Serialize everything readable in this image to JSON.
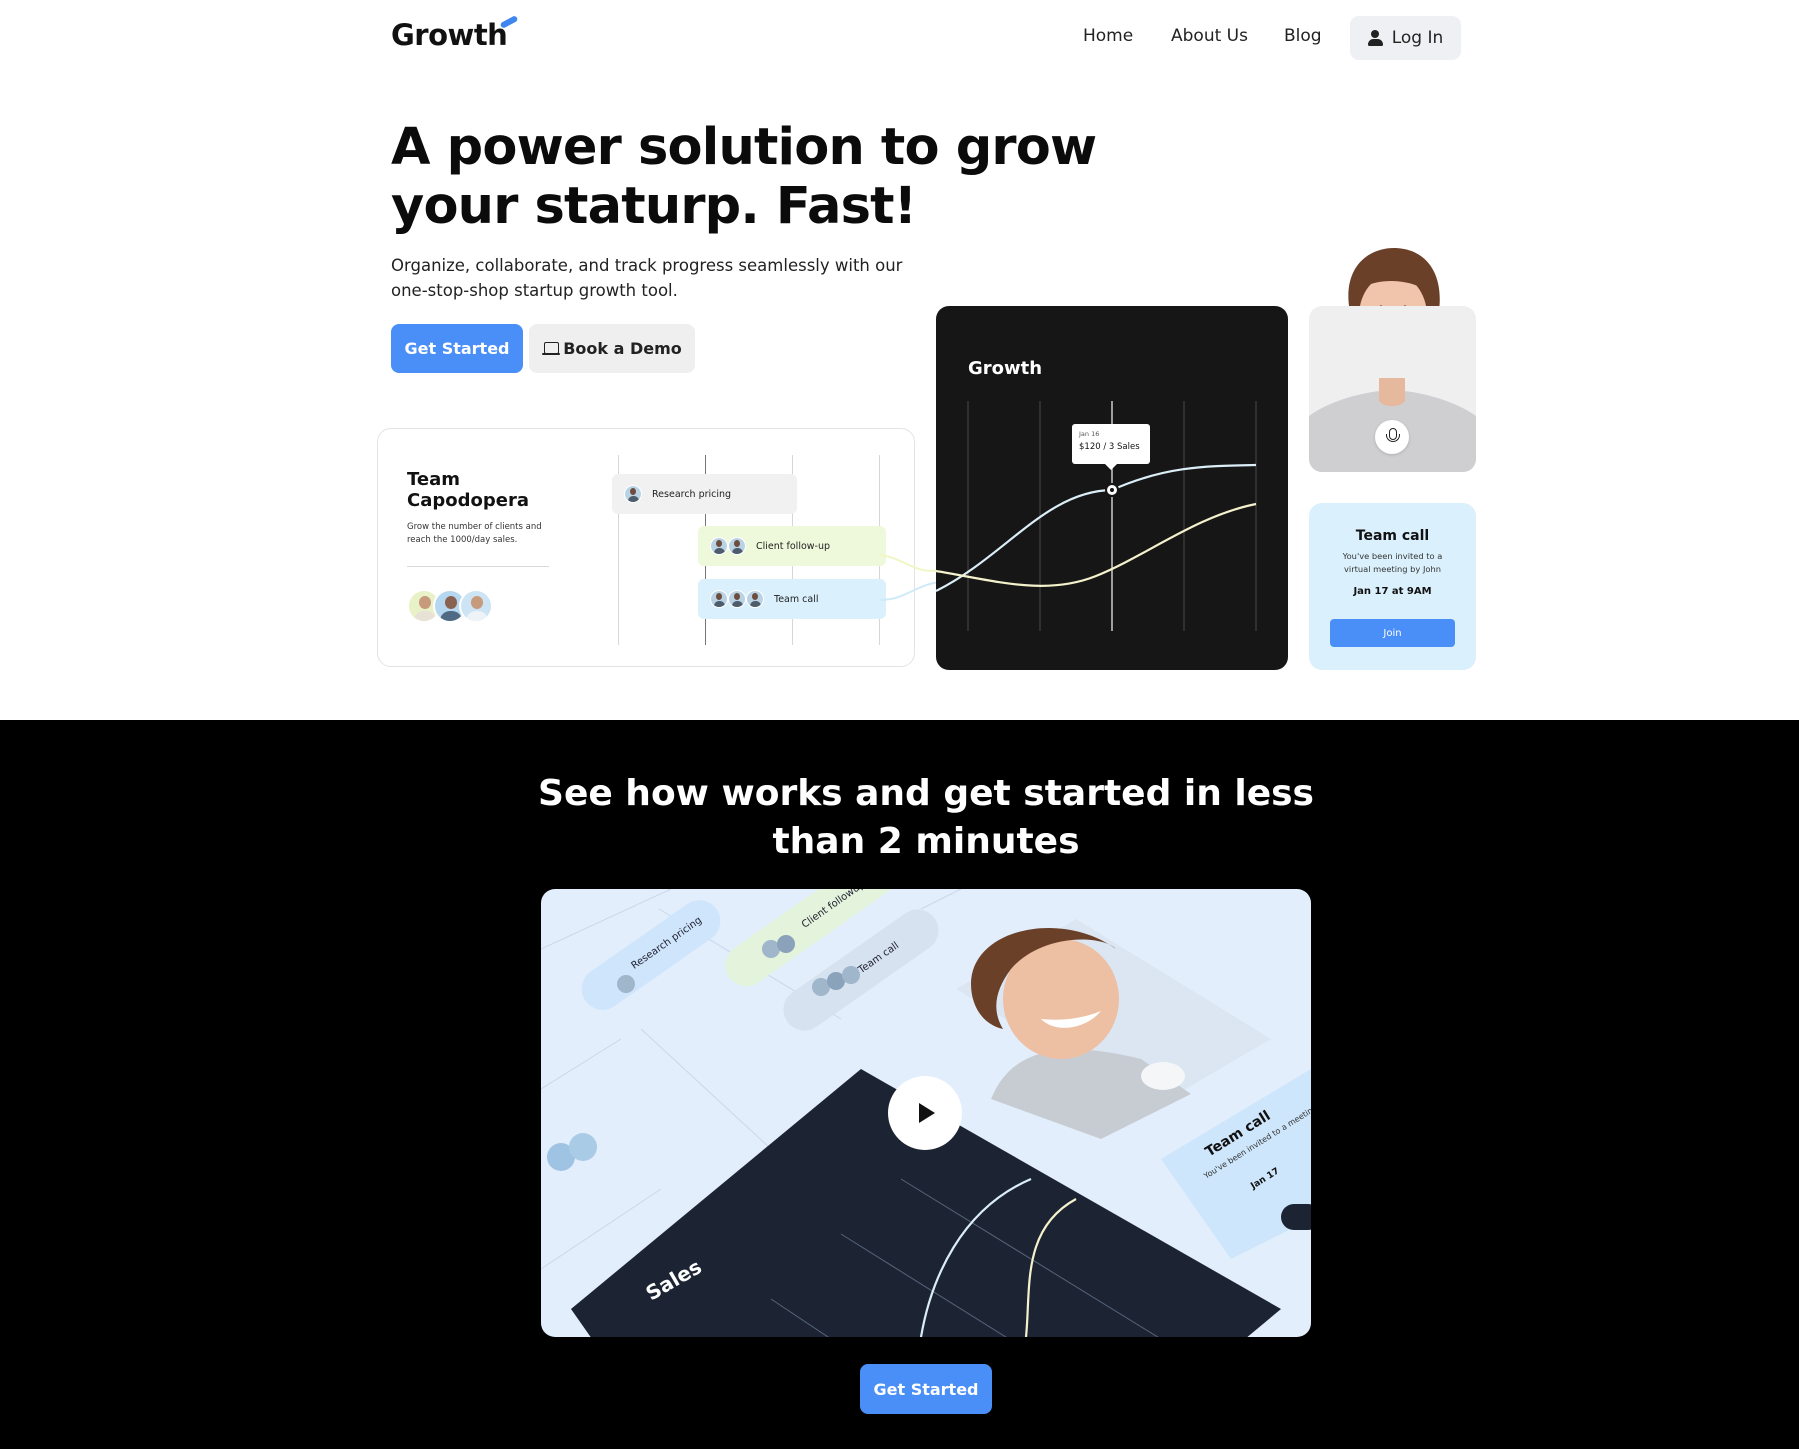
{
  "nav": {
    "logo": "Growth",
    "links": [
      "Home",
      "About Us",
      "Blog"
    ],
    "login_label": "Log In"
  },
  "hero": {
    "title": "A power solution to grow your staturp. Fast!",
    "subtitle": "Organize, collaborate, and track progress seamlessly with our one-stop-shop startup growth tool.",
    "primary_cta": "Get Started",
    "secondary_cta": "Book a Demo"
  },
  "team_card": {
    "name": "Team Capodopera",
    "description": "Grow the number of clients and reach the 1000/day sales.",
    "tasks": [
      "Research pricing",
      "Client follow-up",
      "Team call"
    ]
  },
  "growth_card": {
    "title": "Growth",
    "tooltip_date": "Jan 16",
    "tooltip_value": "$120 / 3 Sales"
  },
  "call_card": {
    "title": "Team call",
    "description": "You've been invited to a virtual meeting by John",
    "date": "Jan 17 at 9AM",
    "join_label": "Join"
  },
  "video_section": {
    "title": "See how works and get started in less than 2 minutes",
    "cta": "Get Started",
    "video_labels": {
      "research": "Research pricing",
      "client": "Client followup",
      "team": "Team call",
      "sales": "Sales",
      "call_title": "Team call",
      "call_desc": "You've been invited to a meeting by John",
      "call_date": "Jan 17"
    }
  },
  "colors": {
    "accent": "#4a8ff7",
    "dark_card": "#161616",
    "call_card_bg": "#daf0fc",
    "client_task_bg": "#eef9db"
  },
  "icons": [
    "user-icon",
    "laptop-icon",
    "microphone-icon",
    "play-icon"
  ]
}
